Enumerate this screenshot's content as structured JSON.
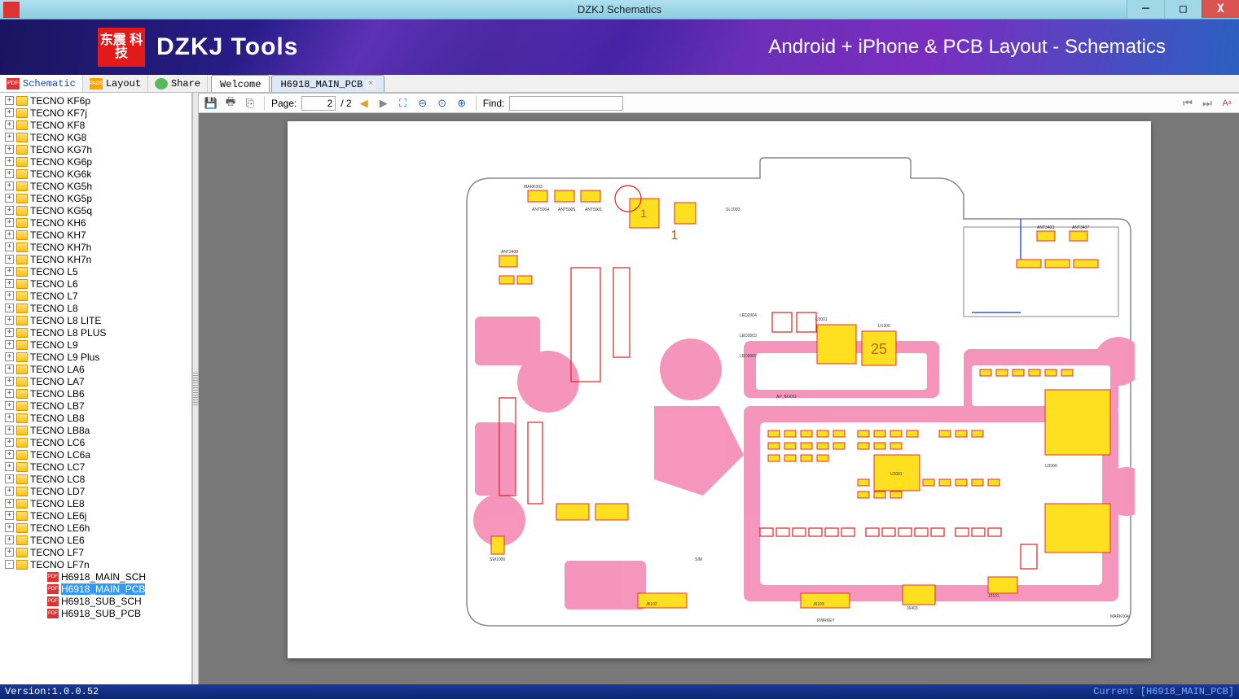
{
  "window": {
    "title": "DZKJ Schematics"
  },
  "banner": {
    "logo_text": "东震\n科技",
    "brand": "DZKJ Tools",
    "tagline": "Android + iPhone & PCB Layout - Schematics"
  },
  "nav_tabs": {
    "schematic": "Schematic",
    "layout": "Layout",
    "share": "Share"
  },
  "doc_tabs": {
    "welcome": "Welcome",
    "active": "H6918_MAIN_PCB"
  },
  "toolbar": {
    "page_label": "Page:",
    "page_value": "2",
    "page_total": "/ 2",
    "find_label": "Find:",
    "find_value": ""
  },
  "tree": {
    "folders": [
      "TECNO KF6p",
      "TECNO KF7j",
      "TECNO KF8",
      "TECNO KG8",
      "TECNO KG7h",
      "TECNO KG6p",
      "TECNO KG6k",
      "TECNO KG5h",
      "TECNO KG5p",
      "TECNO KG5q",
      "TECNO KH6",
      "TECNO KH7",
      "TECNO KH7h",
      "TECNO KH7n",
      "TECNO L5",
      "TECNO L6",
      "TECNO L7",
      "TECNO L8",
      "TECNO L8 LITE",
      "TECNO L8 PLUS",
      "TECNO L9",
      "TECNO L9 Plus",
      "TECNO LA6",
      "TECNO LA7",
      "TECNO LB6",
      "TECNO LB7",
      "TECNO LB8",
      "TECNO LB8a",
      "TECNO LC6",
      "TECNO LC6a",
      "TECNO LC7",
      "TECNO LC8",
      "TECNO LD7",
      "TECNO LE8",
      "TECNO LE6j",
      "TECNO LE6h",
      "TECNO LE6",
      "TECNO LF7"
    ],
    "expanded_folder": "TECNO LF7n",
    "files": [
      "H6918_MAIN_SCH",
      "H6918_MAIN_PCB",
      "H6918_SUB_SCH",
      "H6918_SUB_PCB"
    ],
    "selected_file_index": 1
  },
  "statusbar": {
    "version": "Version:1.0.0.52",
    "current": "Current [H6918_MAIN_PCB]"
  }
}
